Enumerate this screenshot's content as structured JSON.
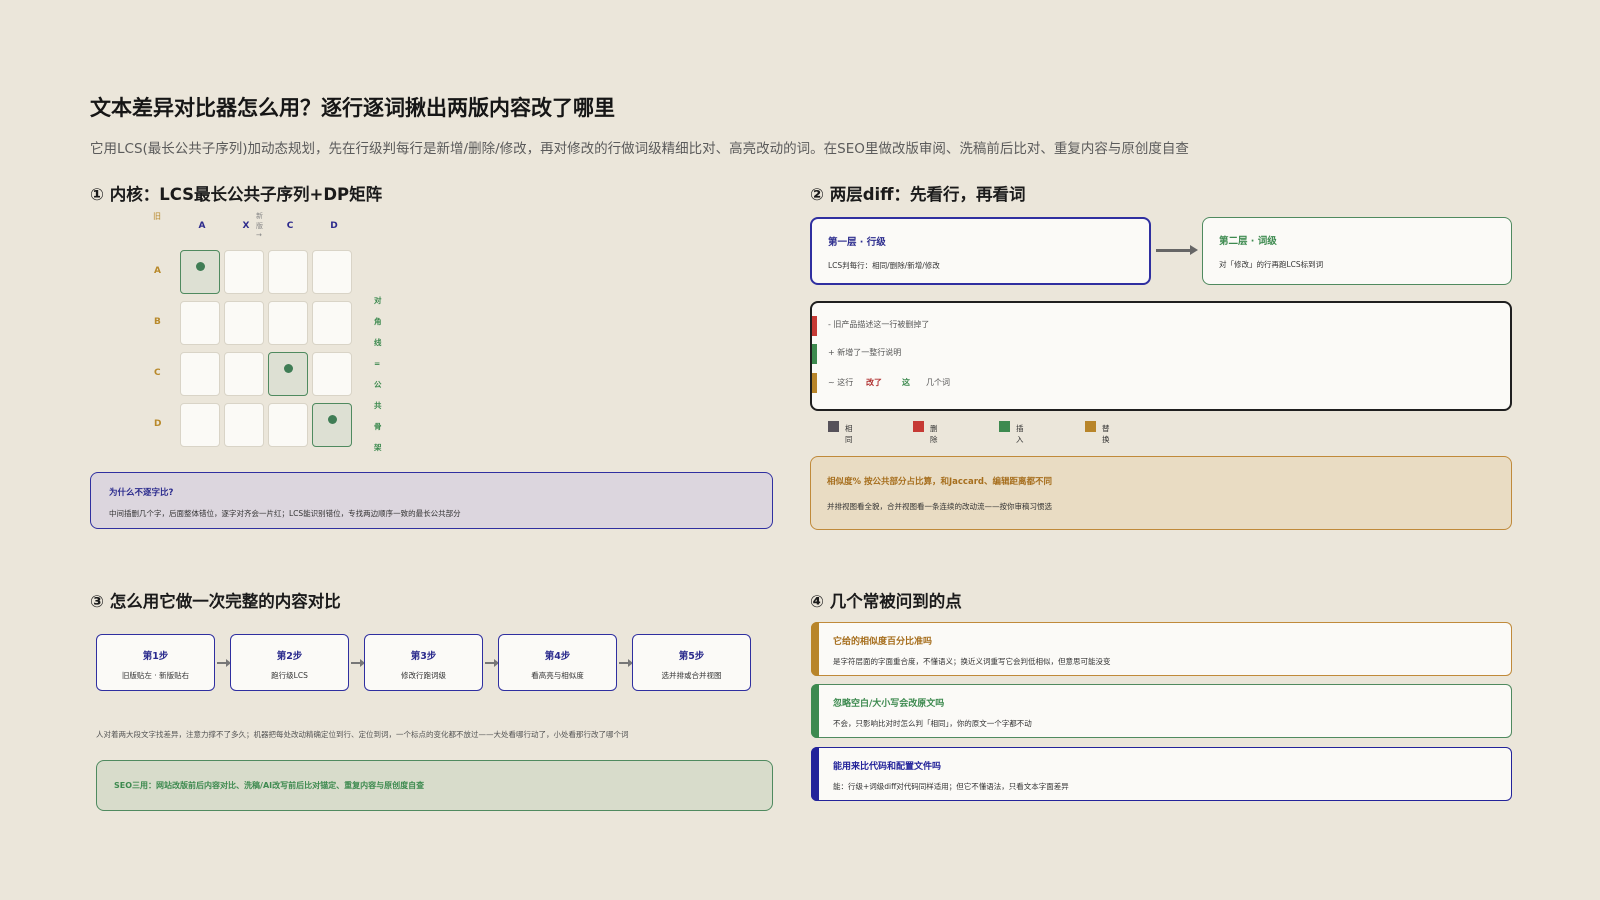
{
  "header": {
    "title": "文本差异对比器怎么用？逐行逐词揪出两版内容改了哪里",
    "subtitle": "它用LCS(最长公共子序列)加动态规划，先在行级判每行是新增/删除/修改，再对修改的行做词级精细比对、高亮改动的词。在SEO里做改版审阅、洗稿前后比对、重复内容与原创度自查"
  },
  "section1": {
    "heading": "① 内核：LCS最长公共子序列+DP矩阵",
    "matrix": {
      "corner_label": "旧",
      "new_label": "新版→",
      "columns": [
        "A",
        "X",
        "C",
        "D"
      ],
      "rows": [
        "A",
        "B",
        "C",
        "D"
      ],
      "matches": [
        [
          0,
          0
        ],
        [
          2,
          2
        ],
        [
          3,
          3
        ]
      ]
    },
    "diag_note_1": "对角线=",
    "diag_note_2": "公共骨架",
    "why_title": "为什么不逐字比?",
    "why_text": "中间插删几个字，后面整体错位，逐字对齐会一片红；LCS能识别错位，专找两边顺序一致的最长公共部分"
  },
  "section2": {
    "heading": "② 两层diff：先看行，再看词",
    "layer1_title": "第一层 · 行级",
    "layer1_text": "LCS判每行：相同/删除/新增/修改",
    "layer2_title": "第二层 · 词级",
    "layer2_text": "对「修改」的行再跑LCS标到词",
    "diff_lines": [
      {
        "text": "- 旧产品描述这一行被删掉了",
        "color": "#c63a35"
      },
      {
        "text": "+ 新增了一整行说明",
        "color": "#3d8a4f"
      }
    ],
    "diff_words": {
      "prefix": "~ 这行",
      "deleted": "改了",
      "inserted": "这",
      "suffix": "几个词",
      "color": "#b8852a"
    },
    "legend": [
      {
        "label": "相同",
        "color": "#56525a"
      },
      {
        "label": "删除",
        "color": "#c63a35"
      },
      {
        "label": "插入",
        "color": "#3d8a4f"
      },
      {
        "label": "替换",
        "color": "#b8852a"
      }
    ],
    "sim_title": "相似度% 按公共部分占比算，和Jaccard、编辑距离都不同",
    "sim_text": "并排视图看全貌，合并视图看一条连续的改动流——按你审稿习惯选"
  },
  "section3": {
    "heading": "③ 怎么用它做一次完整的内容对比",
    "steps": [
      {
        "title": "第1步",
        "desc": "旧版贴左 · 新版贴右"
      },
      {
        "title": "第2步",
        "desc": "跑行级LCS"
      },
      {
        "title": "第3步",
        "desc": "修改行跑词级"
      },
      {
        "title": "第4步",
        "desc": "看高亮与相似度"
      },
      {
        "title": "第5步",
        "desc": "选并排或合并视图"
      }
    ],
    "note": "人对着两大段文字找差异，注意力撑不了多久；机器把每处改动精确定位到行、定位到词，一个标点的变化都不放过——大处看哪行动了，小处看那行改了哪个词",
    "seo_text": "SEO三用：网站改版前后内容对比、洗稿/AI改写前后比对锚定、重复内容与原创度自查"
  },
  "section4": {
    "heading": "④ 几个常被问到的点",
    "faqs": [
      {
        "q": "它给的相似度百分比准吗",
        "a": "是字符层面的字面重合度，不懂语义；换近义词重写它会判低相似，但意思可能没变",
        "color": "#b8852a",
        "qcolor": "#a66e1d"
      },
      {
        "q": "忽略空白/大小写会改原文吗",
        "a": "不会，只影响比对时怎么判「相同」，你的原文一个字都不动",
        "color": "#3d8a4f",
        "qcolor": "#3d8a4f"
      },
      {
        "q": "能用来比代码和配置文件吗",
        "a": "能：行级+词级diff对代码同样适用；但它不懂语法，只看文本字面差异",
        "color": "#23239a",
        "qcolor": "#23239a"
      }
    ]
  }
}
